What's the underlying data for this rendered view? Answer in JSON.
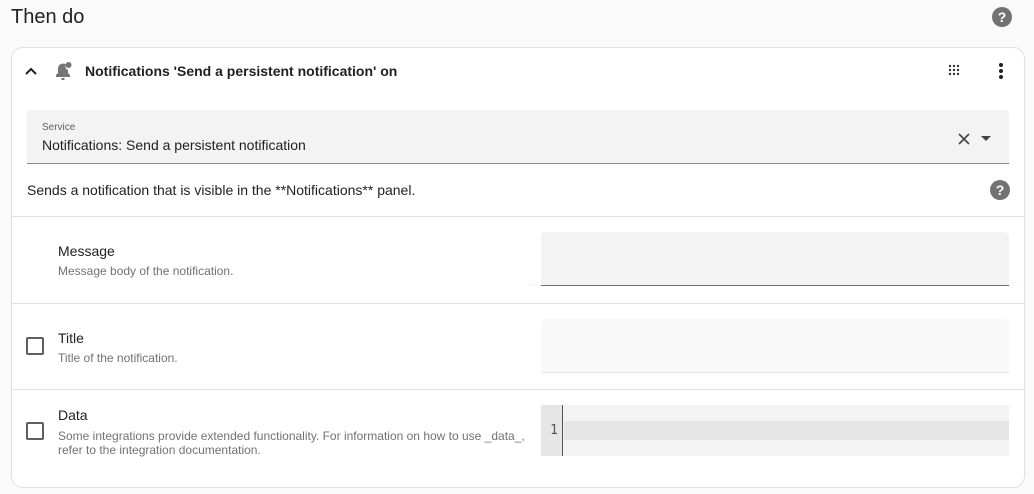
{
  "section_title": "Then do",
  "action": {
    "header": "Notifications 'Send a persistent notification' on",
    "service": {
      "label": "Service",
      "value": "Notifications: Send a persistent notification"
    },
    "description": "Sends a notification that is visible in the **Notifications** panel.",
    "fields": [
      {
        "name": "Message",
        "description": "Message body of the notification.",
        "value": ""
      },
      {
        "name": "Title",
        "description": "Title of the notification.",
        "value": "",
        "checked": false
      },
      {
        "name": "Data",
        "description": "Some integrations provide extended functionality. For information on how to use _data_, refer to the integration documentation.",
        "checked": false,
        "line_number": "1"
      }
    ]
  },
  "colors": {
    "error_underline": "#db4437",
    "help_icon": "#727272"
  }
}
